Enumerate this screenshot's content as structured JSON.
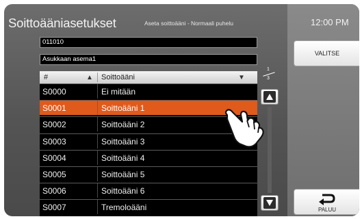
{
  "header": {
    "title": "Soittoääniasetukset",
    "subtitle": "Aseta soittoääni - Normaali puhelu",
    "clock": "12:00 PM"
  },
  "fields": {
    "number": "011010",
    "name": "Asukkaan asema1"
  },
  "table": {
    "columns": [
      "#",
      "Soittoääni"
    ],
    "rows": [
      {
        "id": "S0000",
        "name": "Ei mitään"
      },
      {
        "id": "S0001",
        "name": "Soittoääni 1"
      },
      {
        "id": "S0002",
        "name": "Soittoääni 2"
      },
      {
        "id": "S0003",
        "name": "Soittoääni 3"
      },
      {
        "id": "S0004",
        "name": "Soittoääni 4"
      },
      {
        "id": "S0005",
        "name": "Soittoääni 5"
      },
      {
        "id": "S0006",
        "name": "Soittoääni 6"
      },
      {
        "id": "S0007",
        "name": "Tremoloääni"
      }
    ],
    "selected_index": 1
  },
  "pagination": {
    "current": "1",
    "total": "3"
  },
  "buttons": {
    "select": "VALITSE",
    "back": "PALUU"
  },
  "colors": {
    "selected_row": "#e05a1c",
    "background": "#5a5a5a"
  },
  "icons": {
    "sort_asc": "triangle-up-icon",
    "sort_desc": "triangle-down-icon",
    "scroll_up": "arrow-up-icon",
    "scroll_down": "arrow-down-icon",
    "back": "return-arrow-icon",
    "pointer": "hand-pointer-icon"
  }
}
